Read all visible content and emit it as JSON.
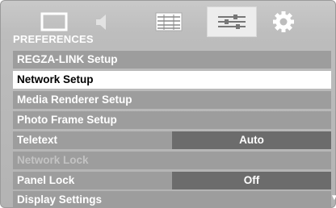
{
  "tabs": [
    {
      "icon": "picture-icon"
    },
    {
      "icon": "sound-icon"
    },
    {
      "icon": "setup-icon"
    },
    {
      "icon": "preferences-icon",
      "active": true
    },
    {
      "icon": "settings-gear-icon"
    }
  ],
  "section_title": "PREFERENCES",
  "menu": {
    "regza_link": {
      "label": "REGZA-LINK Setup"
    },
    "network": {
      "label": "Network Setup"
    },
    "media_renderer": {
      "label": "Media Renderer Setup"
    },
    "photo_frame": {
      "label": "Photo Frame Setup"
    },
    "teletext": {
      "label": "Teletext",
      "value": "Auto"
    },
    "network_lock": {
      "label": "Network Lock"
    },
    "panel_lock": {
      "label": "Panel Lock",
      "value": "Off"
    },
    "display_settings": {
      "label": "Display Settings"
    }
  },
  "scroll_indicator": "▼",
  "colors": {
    "background": "#bdbdbd",
    "row": "#9d9d9d",
    "selected_row": "#ffffff",
    "value_box": "#6c6c6c",
    "disabled_text": "#c3c3c3"
  }
}
